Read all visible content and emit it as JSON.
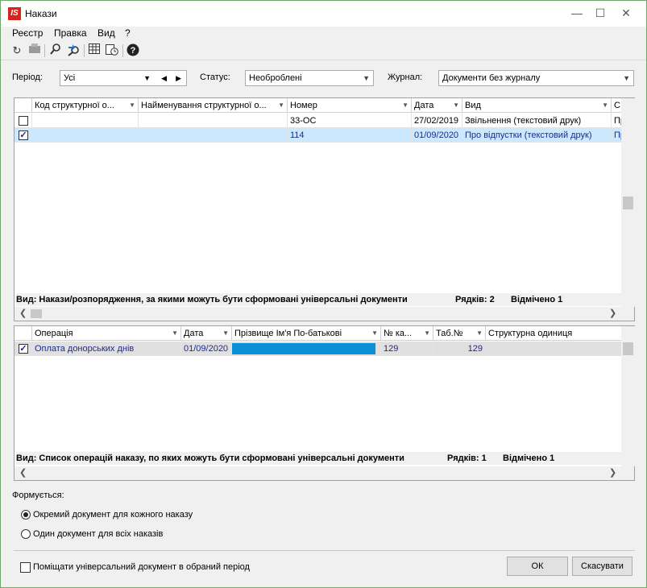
{
  "window": {
    "title": "Накази",
    "icon": "is-app-icon"
  },
  "menu": [
    "Реєстр",
    "Правка",
    "Вид",
    "?"
  ],
  "toolbar": {
    "icons": [
      "refresh-icon",
      "print-icon",
      "search-icon",
      "find-next-icon",
      "table-icon",
      "schedule-icon",
      "help-icon"
    ]
  },
  "filters": {
    "period_label": "Період:",
    "period_value": "Усі",
    "status_label": "Статус:",
    "status_value": "Необроблені",
    "journal_label": "Журнал:",
    "journal_value": "Документи без журналу"
  },
  "orders_table": {
    "columns": [
      "Код структурної о...",
      "Найменування структурної о...",
      "Номер",
      "Дата",
      "Вид",
      "С"
    ],
    "rows": [
      {
        "checked": false,
        "code": "",
        "name": "",
        "number": "33-ОС",
        "date": "27/02/2019",
        "kind": "Звільнення (текстовий друк)",
        "status": "Пр"
      },
      {
        "checked": true,
        "code": "",
        "name": "",
        "number": "114",
        "date": "01/09/2020",
        "kind": "Про відпустки (текстовий друк)",
        "status": "Пр"
      }
    ],
    "status_text": "Вид: Накази/розпорядження, за якими можуть бути сформовані універсальні документи",
    "rows_count": "Рядків: 2",
    "marked_count": "Відмічено 1"
  },
  "operations_table": {
    "columns": [
      "Операція",
      "Дата",
      "Прізвище Ім'я По-батькові",
      "№ ка...",
      "Таб.№",
      "Структурна одиниця"
    ],
    "rows": [
      {
        "checked": true,
        "operation": "Оплата донорських днів",
        "date": "01/09/2020",
        "fio": "",
        "card_no": "129",
        "tab_no": "129",
        "unit": ""
      }
    ],
    "status_text": "Вид: Список операцій наказу, по яких можуть бути сформовані універсальні документи",
    "rows_count": "Рядків: 1",
    "marked_count": "Відмічено 1"
  },
  "forming": {
    "label": "Формується:",
    "option1": "Окремий документ для кожного наказу",
    "option2": "Один документ для всіх наказів",
    "selected": 1
  },
  "footer": {
    "checkbox_label": "Поміщати універсальний документ в обраний період",
    "checkbox_checked": false,
    "ok": "ОК",
    "cancel": "Скасувати"
  },
  "colors": {
    "selection": "#cce8ff",
    "redacted": "#0a8fd6",
    "brand": "#d9241b"
  }
}
